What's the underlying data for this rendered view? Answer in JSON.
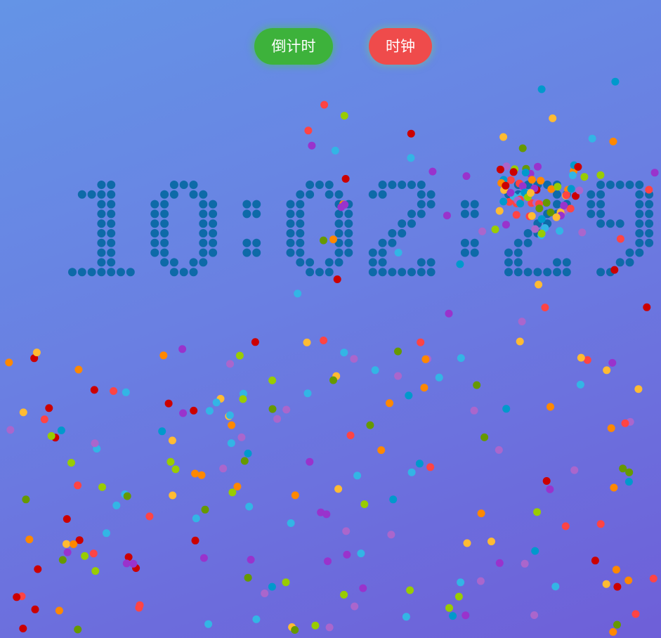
{
  "buttons": {
    "countdown": "倒计时",
    "clock": "时钟"
  },
  "clock": {
    "time": "10:02:29",
    "digit_color": "#0e6aa8"
  },
  "ball_colors": [
    "#33b5e5",
    "#0099cc",
    "#aa66cc",
    "#9933cc",
    "#99cc00",
    "#669900",
    "#ffbb33",
    "#ff8800",
    "#ff4444",
    "#cc0000"
  ]
}
